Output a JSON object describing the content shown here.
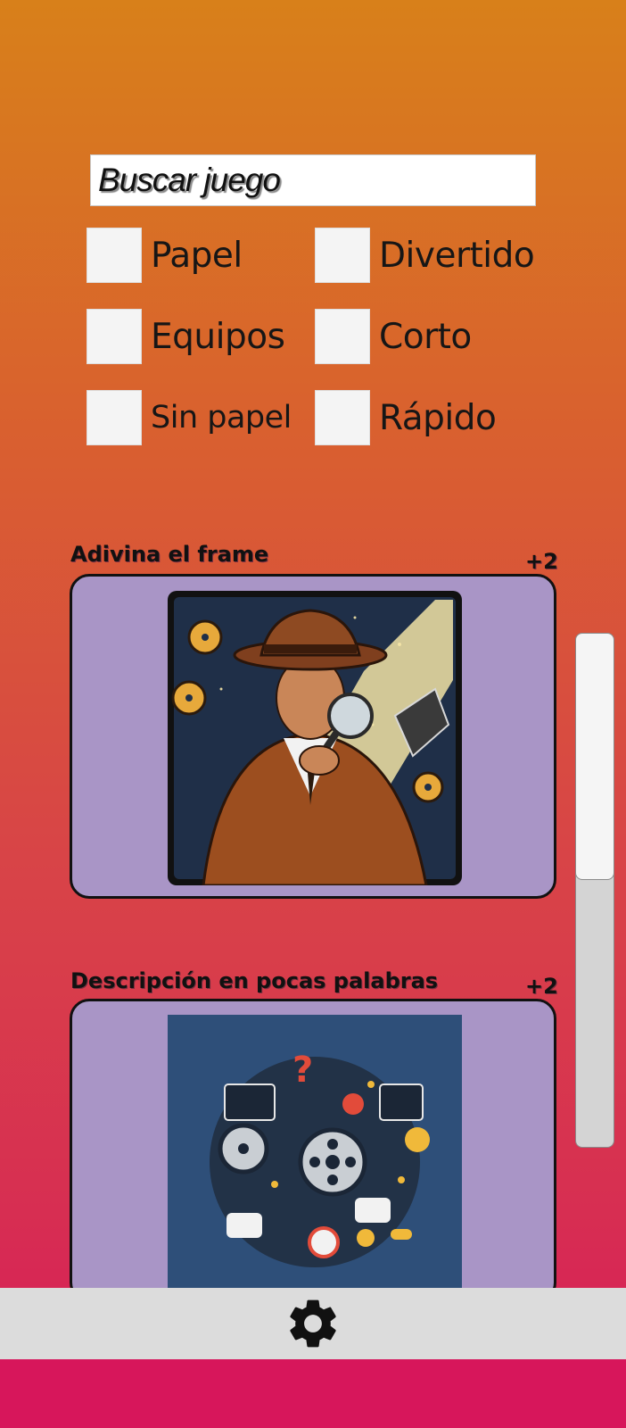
{
  "search": {
    "placeholder": "Buscar juego"
  },
  "filters": [
    {
      "label": "Papel",
      "checked": false
    },
    {
      "label": "Divertido",
      "checked": false
    },
    {
      "label": "Equipos",
      "checked": false
    },
    {
      "label": "Corto",
      "checked": false
    },
    {
      "label": "Sin papel",
      "checked": false
    },
    {
      "label": "Rápido",
      "checked": false
    }
  ],
  "games": [
    {
      "title": "Adivina el frame",
      "count": "+2",
      "image": "detective-film-icon"
    },
    {
      "title": "Descripción en pocas palabras",
      "count": "+2",
      "image": "film-words-collage-icon"
    }
  ],
  "bottom_bar": {
    "icon": "gear-icon"
  },
  "colors": {
    "card_bg": "#a995c6",
    "bottom_bar": "#dcdcdc",
    "bottom_strip": "#d7165b"
  }
}
